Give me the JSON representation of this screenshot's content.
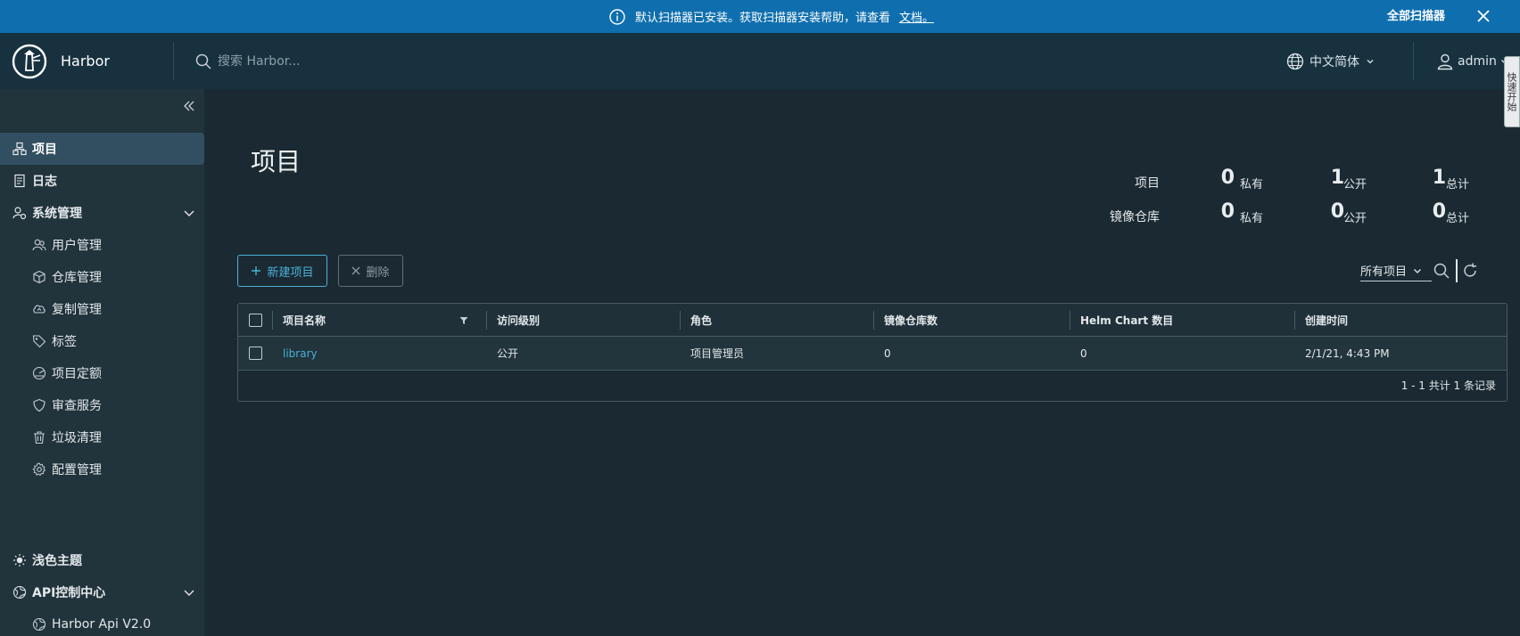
{
  "banner": {
    "message": "默认扫描器已安装。获取扫描器安装帮助，请查看",
    "doc_link": "文档。",
    "scan_all": "全部扫描器",
    "bg": "#0f6fae"
  },
  "header": {
    "brand": "Harbor",
    "search_placeholder": "搜索 Harbor...",
    "language": "中文简体",
    "user": "admin",
    "side_tab": "快速开始"
  },
  "sidebar": {
    "items": [
      {
        "label": "项目",
        "icon": "projects-icon",
        "active": true
      },
      {
        "label": "日志",
        "icon": "logs-icon"
      },
      {
        "label": "系统管理",
        "icon": "admin-icon"
      },
      {
        "label": "用户管理",
        "icon": "users-icon"
      },
      {
        "label": "仓库管理",
        "icon": "registry-icon"
      },
      {
        "label": "复制管理",
        "icon": "replication-icon"
      },
      {
        "label": "标签",
        "icon": "tag-icon"
      },
      {
        "label": "项目定额",
        "icon": "quota-icon"
      },
      {
        "label": "审查服务",
        "icon": "shield-icon"
      },
      {
        "label": "垃圾清理",
        "icon": "trash-icon"
      },
      {
        "label": "配置管理",
        "icon": "gear-icon"
      }
    ],
    "theme_toggle": "浅色主题",
    "api_center": "API控制中心",
    "api_item": "Harbor Api V2.0"
  },
  "main": {
    "title": "项目",
    "stats": {
      "projects_label": "项目",
      "repos_label": "镜像仓库",
      "private_unit": "私有",
      "public_unit": "公开",
      "total_unit": "总计",
      "projects": {
        "private": "0",
        "public": "1",
        "total": "1"
      },
      "repos": {
        "private": "0",
        "public": "0",
        "total": "0"
      }
    },
    "new_project_btn": "新建项目",
    "delete_btn": "删除",
    "filter_select": "所有项目",
    "table": {
      "columns": [
        "项目名称",
        "访问级别",
        "角色",
        "镜像仓库数",
        "Helm Chart 数目",
        "创建时间"
      ],
      "rows": [
        [
          "library",
          "公开",
          "项目管理员",
          "0",
          "0",
          "2/1/21, 4:43 PM"
        ]
      ],
      "footer": "1 - 1 共计 1 条记录"
    }
  },
  "colors": {
    "accent": "#49afd9",
    "header": "#17313f",
    "sidebar": "#21333b",
    "main_bg": "#1b2a32"
  }
}
